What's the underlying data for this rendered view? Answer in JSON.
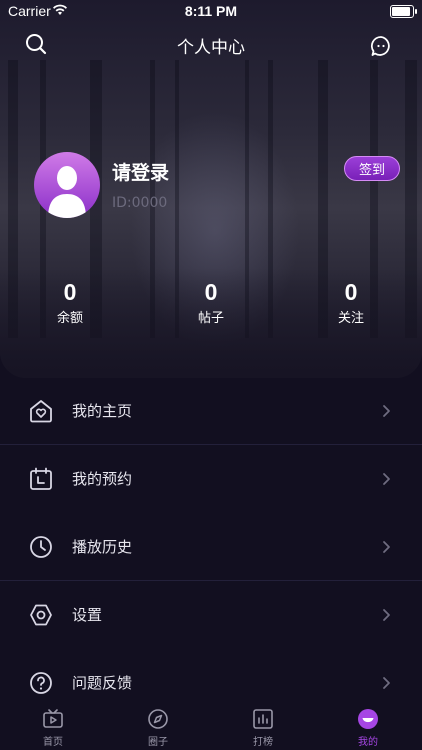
{
  "status_bar": {
    "carrier": "Carrier",
    "time": "8:11 PM"
  },
  "header": {
    "title": "个人中心",
    "search_icon": "search-icon",
    "message_icon": "message-icon"
  },
  "profile": {
    "name": "请登录",
    "id_text": "ID:0000",
    "checkin_label": "签到",
    "accent_color": "#9b3fd8"
  },
  "stats": [
    {
      "value": "0",
      "label": "余额"
    },
    {
      "value": "0",
      "label": "帖子"
    },
    {
      "value": "0",
      "label": "关注"
    }
  ],
  "menu": [
    {
      "label": "我的主页",
      "icon": "home-heart-icon"
    },
    {
      "label": "我的预约",
      "icon": "calendar-icon"
    },
    {
      "label": "播放历史",
      "icon": "clock-icon"
    },
    {
      "label": "设置",
      "icon": "hexagon-settings-icon"
    },
    {
      "label": "问题反馈",
      "icon": "question-icon"
    }
  ],
  "tabbar": {
    "items": [
      {
        "label": "首页",
        "icon": "tv-play-icon"
      },
      {
        "label": "圈子",
        "icon": "compass-icon"
      },
      {
        "label": "打榜",
        "icon": "chart-icon"
      },
      {
        "label": "我的",
        "icon": "profile-smile-icon"
      }
    ],
    "active_index": 3,
    "active_color": "#a646e4",
    "inactive_color": "#9997a8"
  }
}
